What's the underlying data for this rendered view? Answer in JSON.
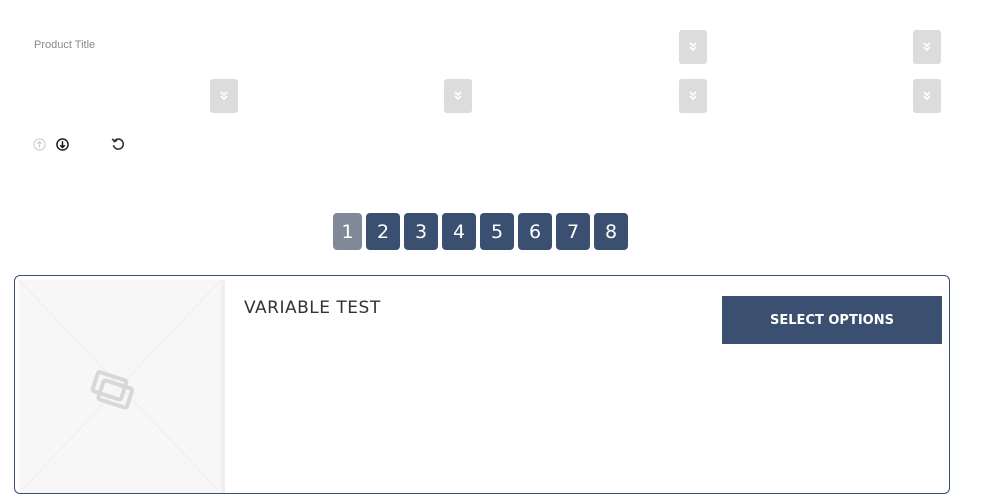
{
  "filters": {
    "product_title_label": "Product Title"
  },
  "icons": {
    "dropdown": "chevron-double-down-icon",
    "sort_up": "arrow-up-circle-icon",
    "sort_down": "arrow-down-circle-icon",
    "reset": "reset-icon",
    "placeholder": "image-placeholder-icon"
  },
  "pagination": {
    "pages": [
      "1",
      "2",
      "3",
      "4",
      "5",
      "6",
      "7",
      "8"
    ],
    "current": "1"
  },
  "product": {
    "title": "VARIABLE TEST",
    "button_label": "SELECT OPTIONS"
  },
  "colors": {
    "primary": "#3b4f70",
    "active_page": "#7f8998",
    "dropdown_bg": "#dcdcdc"
  }
}
